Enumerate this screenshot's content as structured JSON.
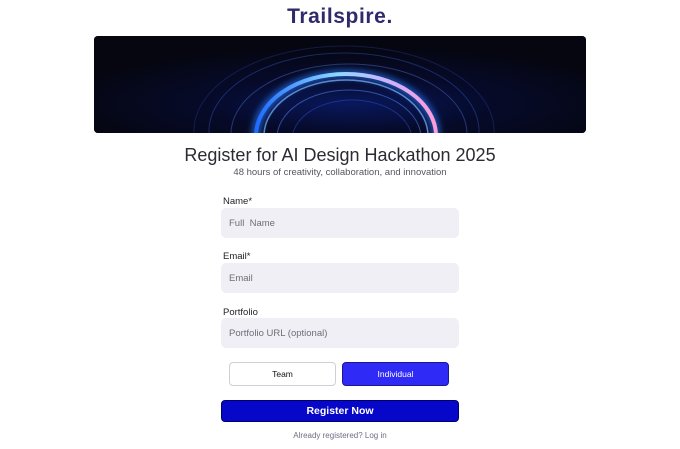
{
  "brand": {
    "name": "Trailspire."
  },
  "hero": {
    "image": "glowing-blue-rings-banner"
  },
  "header": {
    "title": "Register for AI Design Hackathon 2025",
    "subtitle": "48 hours of creativity, collaboration, and innovation"
  },
  "form": {
    "name": {
      "label": "Name*",
      "placeholder": "Full  Name",
      "value": ""
    },
    "email": {
      "label": "Email*",
      "placeholder": "Email",
      "value": ""
    },
    "portfolio": {
      "label": "Portfolio",
      "placeholder": "Portfolio URL (optional)",
      "value": ""
    },
    "participation": {
      "options": [
        "Team",
        "Individual"
      ],
      "selected": "Individual"
    },
    "submit_label": "Register Now"
  },
  "footer": {
    "prompt": "Already registered?",
    "login_label": "Log in"
  },
  "colors": {
    "brand": "#2f2a6b",
    "selected_toggle": "#2f2af5",
    "primary_button": "#0707c9",
    "input_bg": "#efeff5"
  }
}
